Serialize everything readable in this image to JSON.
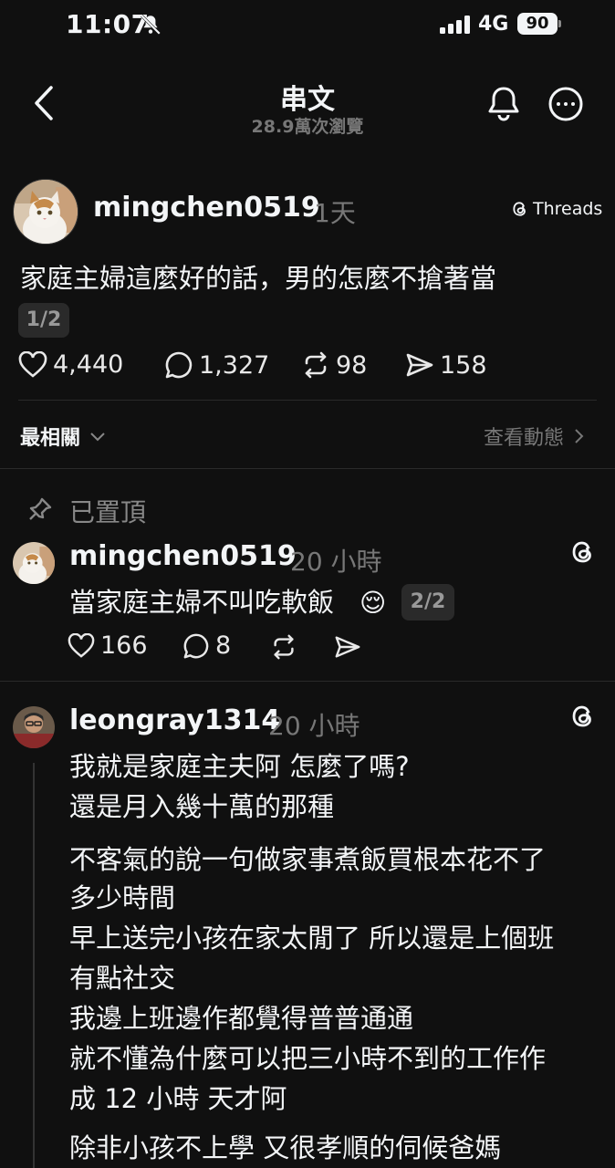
{
  "status_bar": {
    "time": "11:07",
    "network": "4G",
    "battery": "90"
  },
  "header": {
    "title": "串文",
    "views": "28.9萬次瀏覽"
  },
  "post": {
    "username": "mingchen0519",
    "time": "1天",
    "threads_label": "Threads",
    "text": "家庭主婦這麼好的話，男的怎麼不搶著當",
    "page_badge": "1/2",
    "likes": "4,440",
    "comments": "1,327",
    "reposts": "98",
    "shares": "158"
  },
  "sort": {
    "label": "最相關",
    "activity_link": "查看動態"
  },
  "pinned": {
    "label": "已置頂",
    "username": "mingchen0519",
    "time": "20 小時",
    "text": "當家庭主婦不叫吃軟飯",
    "emoji": "😌",
    "page_badge": "2/2",
    "likes": "166",
    "comments": "8"
  },
  "reply": {
    "username": "leongray1314",
    "time": "20 小時",
    "lines": [
      "我就是家庭主夫阿 怎麼了嗎?",
      "還是月入幾十萬的那種",
      "不客氣的說一句做家事煮飯買根本花不了",
      "多少時間",
      "早上送完小孩在家太閒了 所以還是上個班",
      "有點社交",
      "我邊上班邊作都覺得普普通通",
      "就不懂為什麼可以把三小時不到的工作作",
      "成 12 小時 天才阿",
      "除非小孩不上學 又很孝順的伺候爸媽"
    ]
  },
  "icons": {
    "back": "chevron-left-icon",
    "bell": "bell-icon",
    "more": "more-icon",
    "threads": "threads-icon",
    "heart": "heart-icon",
    "comment": "comment-icon",
    "repost": "repost-icon",
    "share": "share-icon",
    "pin": "pin-icon"
  },
  "colors": {
    "background": "#101010",
    "text": "#f3f5f7",
    "muted": "#777777"
  }
}
